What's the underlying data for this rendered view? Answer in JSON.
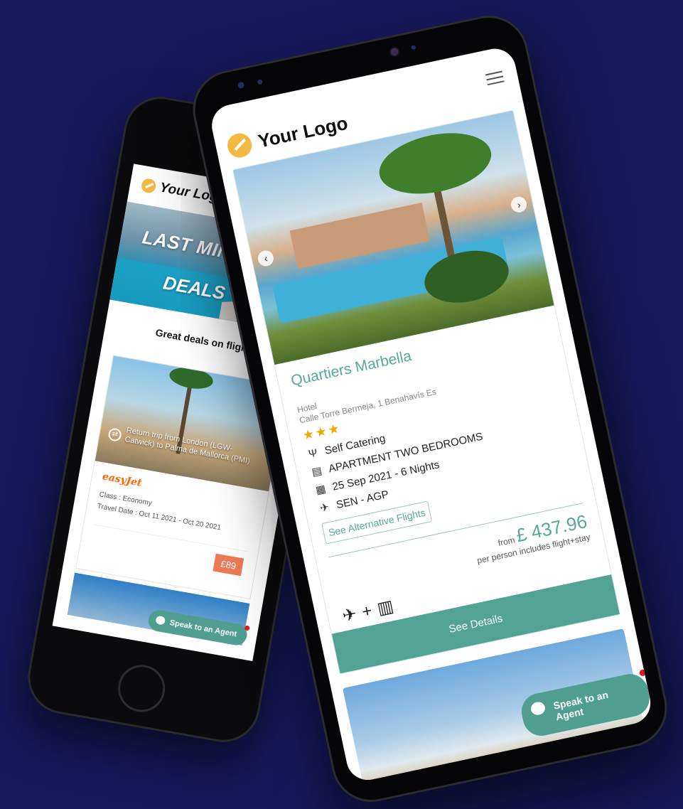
{
  "colors": {
    "background": "#17185a",
    "accent": "#52a393",
    "price_badge": "#ee7a55",
    "stars": "#f2a900",
    "notification": "#e3161f"
  },
  "back_phone": {
    "logo_text": "Your Logo",
    "hero": {
      "line1": "LAST MINUT",
      "line2": "DEALS"
    },
    "subheading": "Great deals on flights",
    "deal_card": {
      "trip_text": "Return trip from London (LGW-Catwick) to Palma de Mallorca (PMI)",
      "airline": "easyJet",
      "class": "Class : Economy",
      "travel_date": "Travel Date : Oct 11 2021 - Oct 20 2021",
      "price": "£89"
    },
    "agent_button": "Speak to an Agent"
  },
  "front_phone": {
    "logo_text": "Your Logo",
    "menu_icon": "hamburger-icon",
    "carousel": {
      "prev": "‹",
      "next": "›"
    },
    "hotel": {
      "name": "Quartiers Marbella",
      "type": "Hotel",
      "address": "Calle Torre Bermeja, 1 Benahavís Es",
      "stars": "★★★",
      "board": "Self Catering",
      "room": "APARTMENT TWO BEDROOMS",
      "dates": "25 Sep 2021 - 6 Nights",
      "route": "SEN - AGP",
      "alt_flights": "See Alternative Flights",
      "price_prefix": "from",
      "price": "£ 437.96",
      "price_note": "per person includes flight+stay",
      "plus": "+",
      "details_button": "See Details"
    },
    "agent_button": "Speak to an Agent"
  }
}
